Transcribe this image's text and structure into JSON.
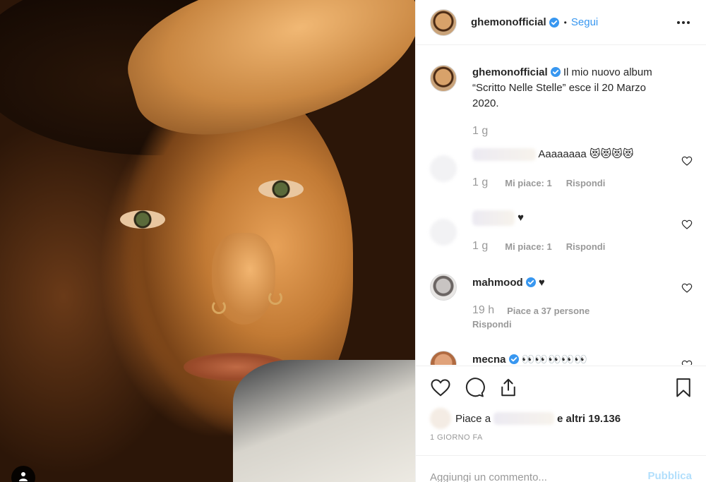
{
  "post": {
    "username": "ghemonofficial",
    "follow_separator": "•",
    "follow_label": "Segui",
    "caption": "Il mio nuovo album “Scritto Nelle Stelle” esce il 20 Marzo 2020.",
    "caption_time": "1 g"
  },
  "comments": [
    {
      "username": "",
      "text": "Aaaaaaaa 😻😻😻😻",
      "time": "1 g",
      "likes": "Mi piace: 1",
      "reply": "Rispondi"
    },
    {
      "username": "",
      "text": "♥",
      "time": "1 g",
      "likes": "Mi piace: 1",
      "reply": "Rispondi"
    },
    {
      "username": "mahmood",
      "text": "♥",
      "time": "19 h",
      "likes": "Piace a 37 persone",
      "reply": "Rispondi"
    },
    {
      "username": "mecna",
      "text": "👀👀👀👀👀"
    }
  ],
  "likes_summary": {
    "prefix": "Piace a",
    "suffix": "e altri 19.136"
  },
  "timestamp": "1 giorno fa",
  "add_comment": {
    "placeholder": "Aggiungi un commento...",
    "publish_label": "Pubblica"
  },
  "icons": {
    "verified": "verified-badge-icon",
    "more": "more-options-icon",
    "like": "heart-icon",
    "comment": "comment-icon",
    "share": "share-icon",
    "save": "bookmark-icon",
    "user_tag": "user-icon"
  },
  "colors": {
    "accent": "#3897f0",
    "publish_disabled": "#b2dffc",
    "meta_text": "#999999"
  }
}
